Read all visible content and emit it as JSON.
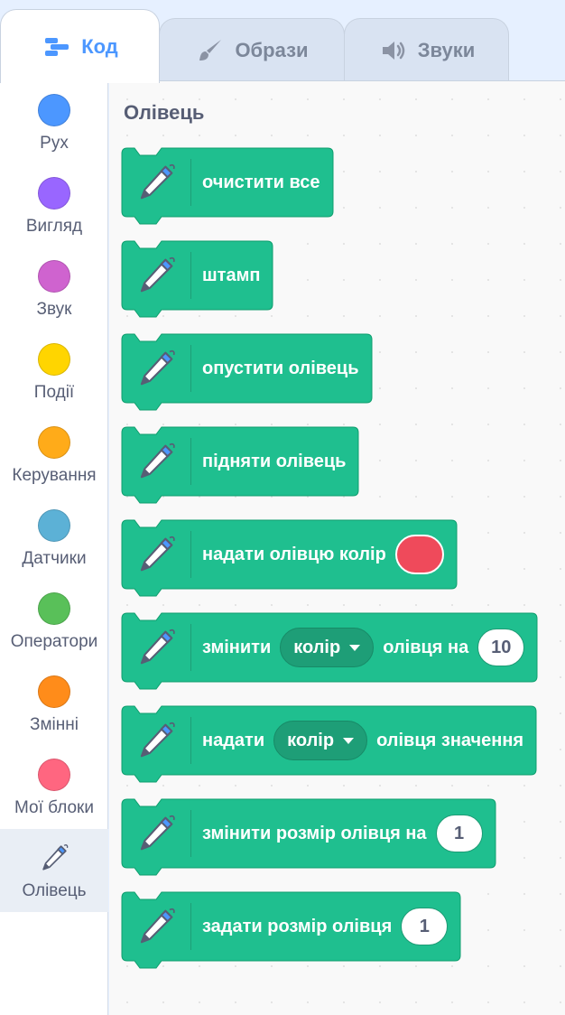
{
  "tabs": {
    "code": "Код",
    "costumes": "Образи",
    "sounds": "Звуки"
  },
  "categories": [
    {
      "id": "motion",
      "label": "Рух",
      "color": "#4c97ff"
    },
    {
      "id": "looks",
      "label": "Вигляд",
      "color": "#9966ff"
    },
    {
      "id": "sound",
      "label": "Звук",
      "color": "#cf63cf"
    },
    {
      "id": "events",
      "label": "Події",
      "color": "#ffd500"
    },
    {
      "id": "control",
      "label": "Керування",
      "color": "#ffab19"
    },
    {
      "id": "sensing",
      "label": "Датчики",
      "color": "#5cb1d6"
    },
    {
      "id": "operators",
      "label": "Оператори",
      "color": "#59c059"
    },
    {
      "id": "variables",
      "label": "Змінні",
      "color": "#ff8c1a"
    },
    {
      "id": "myblocks",
      "label": "Мої блоки",
      "color": "#ff6680"
    },
    {
      "id": "pen",
      "label": "Олівець",
      "icon": "pen-icon",
      "selected": true
    }
  ],
  "palette": {
    "title": "Олівець",
    "block_color": "#1fbf8f",
    "blocks": [
      {
        "text": "очистити все"
      },
      {
        "text": "штамп"
      },
      {
        "text": "опустити олівець"
      },
      {
        "text": "підняти олівець"
      },
      {
        "text": "надати олівцю колір",
        "swatch_color": "#ef4a5b"
      },
      {
        "text": "змінити",
        "dropdown": "колір",
        "text2": "олівця на",
        "value": "10"
      },
      {
        "text": "надати",
        "dropdown": "колір",
        "text2": "олівця значення"
      },
      {
        "text": "змінити розмір олівця на",
        "value": "1"
      },
      {
        "text": "задати розмір олівця",
        "value": "1"
      }
    ]
  }
}
